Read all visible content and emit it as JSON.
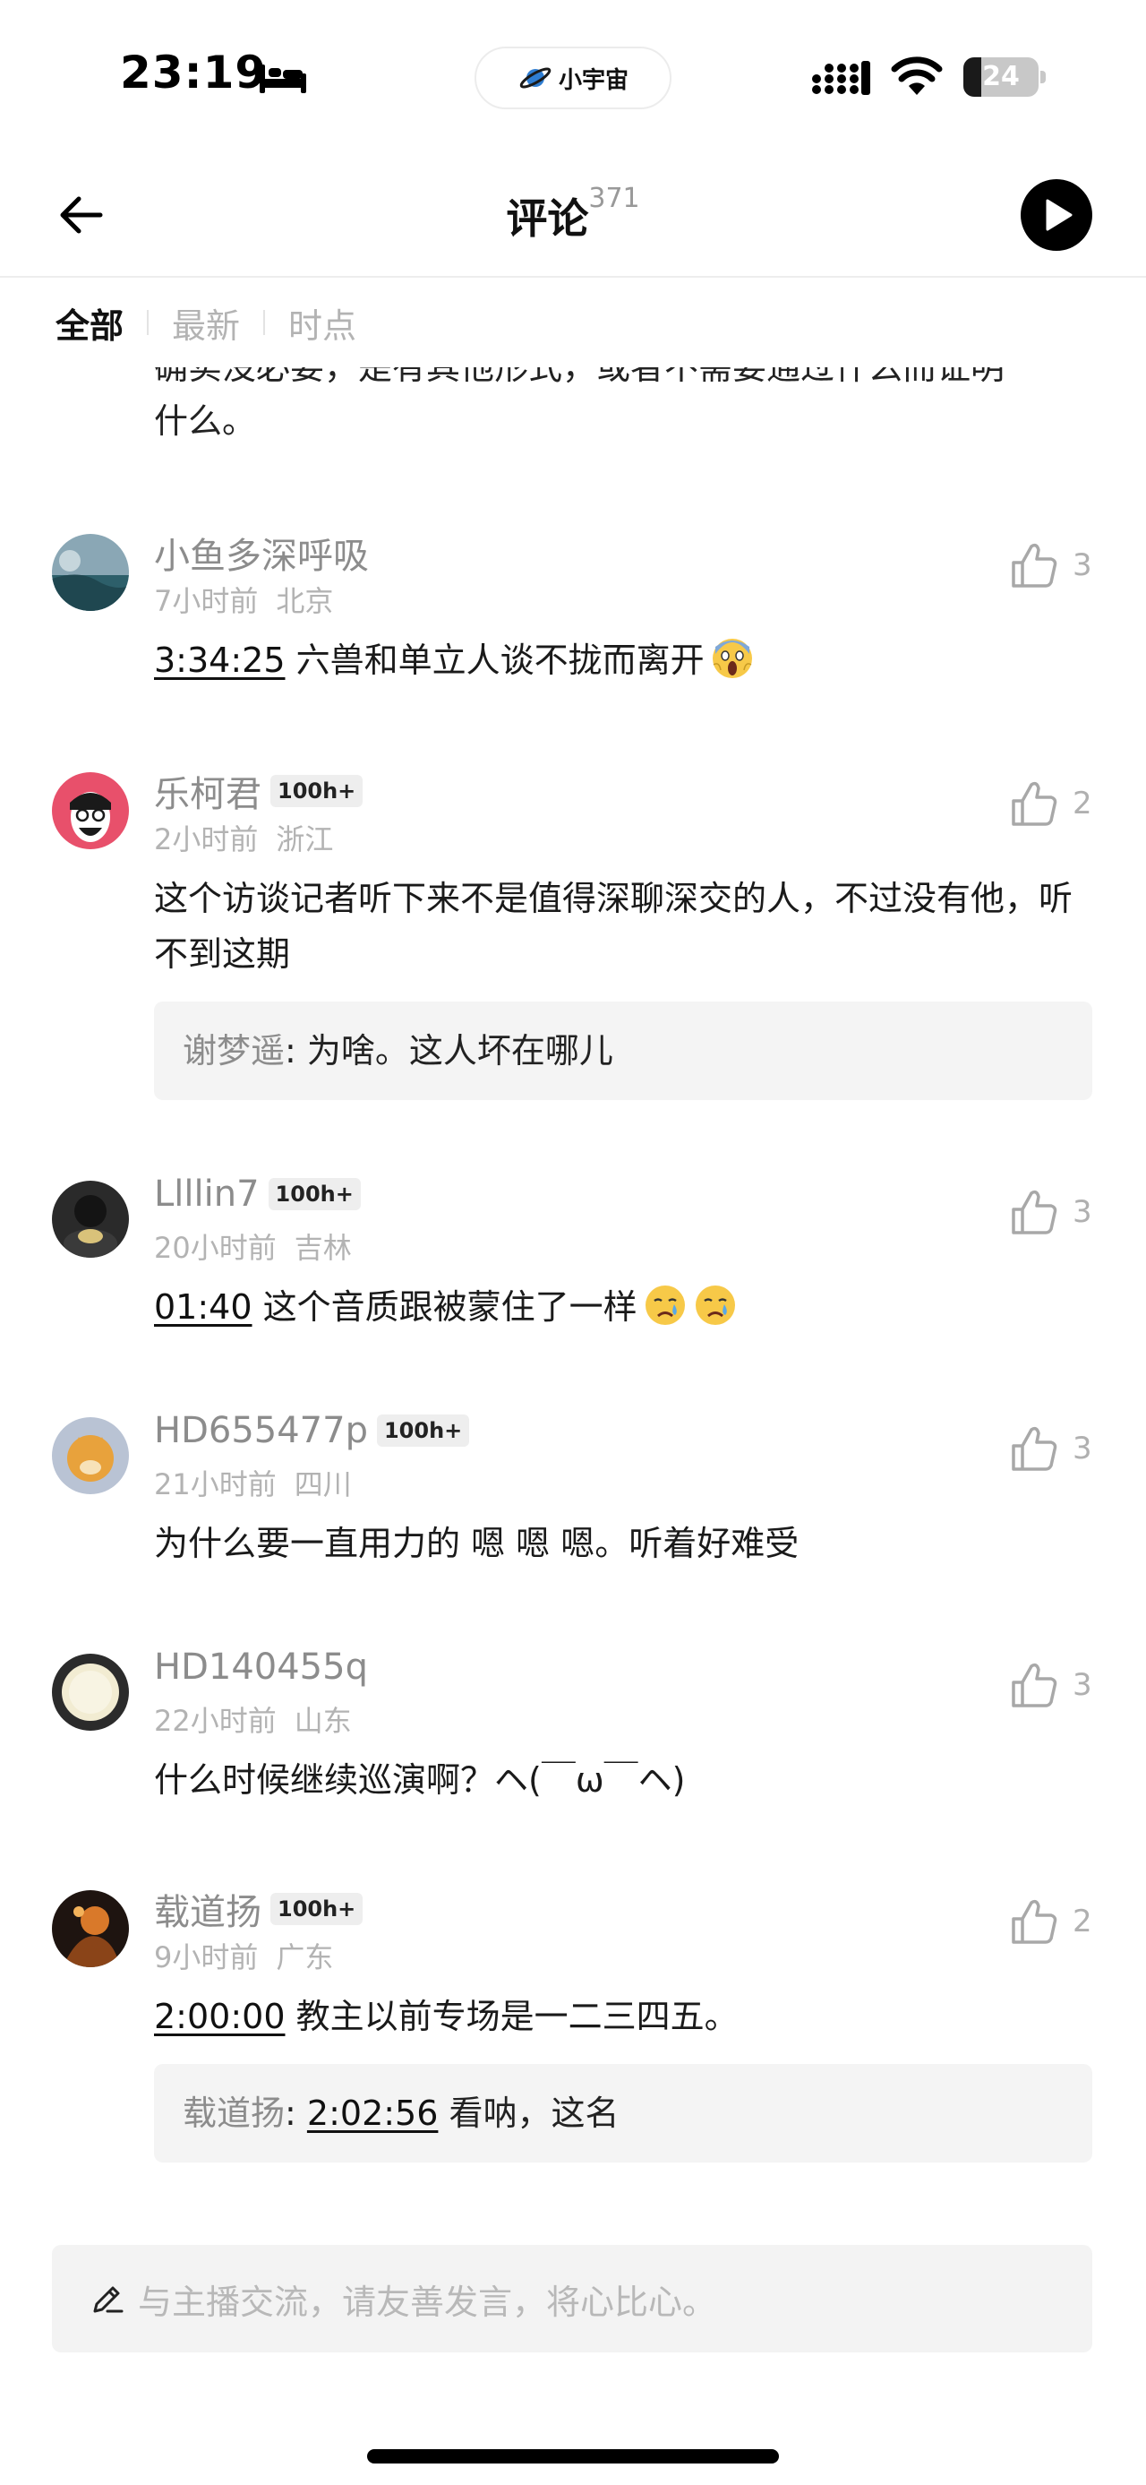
{
  "status_bar": {
    "time": "23:19",
    "app_pill_label": "小宇宙",
    "battery_level": "24",
    "battery_fraction": 0.24
  },
  "nav": {
    "title": "评论",
    "count": "371"
  },
  "tabs": [
    {
      "label": "全部",
      "active": true
    },
    {
      "label": "最新",
      "active": false
    },
    {
      "label": "时点",
      "active": false
    }
  ],
  "partial_comment": {
    "line1": "确实没必要，是有其他形式，或者不需要通过什么而证明",
    "line2": "什么。"
  },
  "comments": [
    {
      "username": "小鱼多深呼吸",
      "badge": "",
      "time_ago": "7小时前",
      "location": "北京",
      "likes": "3",
      "timestamp": "3:34:25",
      "text": "六兽和单立人谈不拢而离开",
      "emoji": "screaming-face-emoji"
    },
    {
      "username": "乐柯君",
      "badge": "100h+",
      "time_ago": "2小时前",
      "location": "浙江",
      "likes": "2",
      "timestamp": "",
      "text": "这个访谈记者听下来不是值得深聊深交的人，不过没有他，听不到这期",
      "reply": {
        "name": "谢梦遥",
        "text": "为啥。这人坏在哪儿"
      }
    },
    {
      "username": "Llllin7",
      "badge": "100h+",
      "time_ago": "20小时前",
      "location": "吉林",
      "likes": "3",
      "timestamp": "01:40",
      "text": "这个音质跟被蒙住了一样",
      "emoji": "crying-face-emoji"
    },
    {
      "username": "HD655477p",
      "badge": "100h+",
      "time_ago": "21小时前",
      "location": "四川",
      "likes": "3",
      "timestamp": "",
      "text": "为什么要一直用力的 嗯 嗯 嗯。听着好难受"
    },
    {
      "username": "HD140455q",
      "badge": "",
      "time_ago": "22小时前",
      "location": "山东",
      "likes": "3",
      "timestamp": "",
      "text": "什么时候继续巡演啊？ヘ(￣ω￣ヘ)"
    },
    {
      "username": "载道扬",
      "badge": "100h+",
      "time_ago": "9小时前",
      "location": "广东",
      "likes": "2",
      "timestamp": "2:00:00",
      "text": "教主以前专场是一二三四五。",
      "reply": {
        "name": "载道扬",
        "timestamp": "2:02:56",
        "text": "看呐，这名"
      }
    }
  ],
  "composer": {
    "placeholder": "与主播交流，请友善发言，将心比心。"
  },
  "colors": {
    "accent_text": "#1a1a1a",
    "muted_text": "#8c8c8c",
    "meta_text": "#b3b3b3",
    "reply_bg": "#f4f4f4"
  }
}
